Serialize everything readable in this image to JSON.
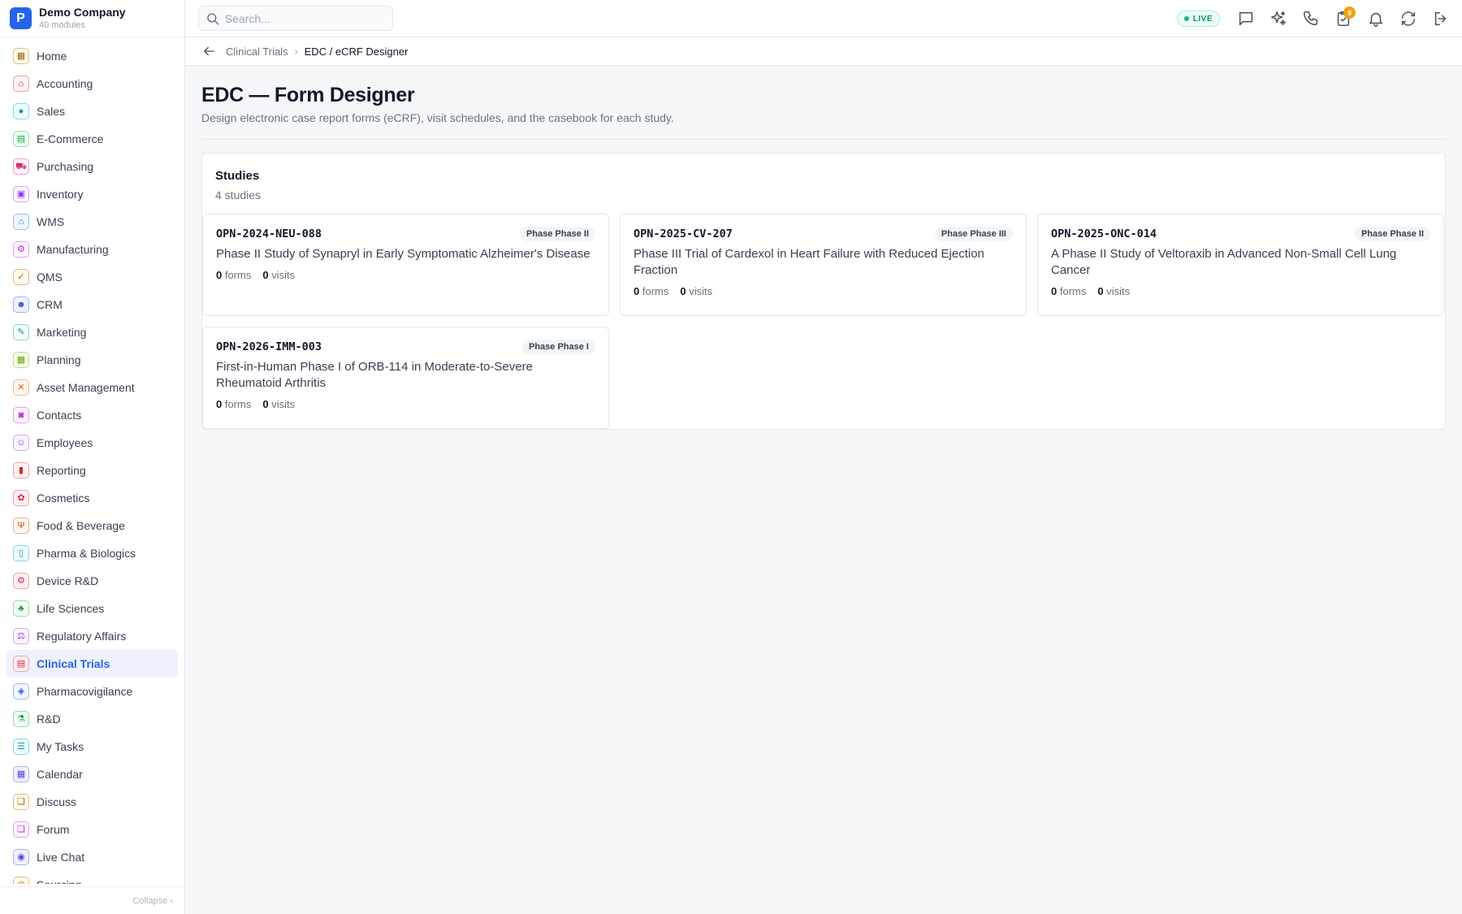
{
  "brand": {
    "logo_letter": "P",
    "name": "Demo Company",
    "subtitle": "40 modules"
  },
  "sidebar": {
    "items": [
      {
        "label": "Home",
        "icon": "home-icon",
        "glyph": "▦",
        "color": "#a16207",
        "bg": "#fefce8",
        "active": false
      },
      {
        "label": "Accounting",
        "icon": "bank-icon",
        "glyph": "⌂",
        "color": "#dc2626",
        "bg": "#fef2f2",
        "active": false
      },
      {
        "label": "Sales",
        "icon": "user-icon",
        "glyph": "●",
        "color": "#0891b2",
        "bg": "#ecfeff",
        "active": false
      },
      {
        "label": "E-Commerce",
        "icon": "store-icon",
        "glyph": "▤",
        "color": "#16a34a",
        "bg": "#f0fdf4",
        "active": false
      },
      {
        "label": "Purchasing",
        "icon": "cart-icon",
        "glyph": "⛟",
        "color": "#db2777",
        "bg": "#fdf2f8",
        "active": false
      },
      {
        "label": "Inventory",
        "icon": "box-icon",
        "glyph": "▣",
        "color": "#9333ea",
        "bg": "#faf5ff",
        "active": false
      },
      {
        "label": "WMS",
        "icon": "warehouse-icon",
        "glyph": "⌂",
        "color": "#2563eb",
        "bg": "#eff6ff",
        "active": false
      },
      {
        "label": "Manufacturing",
        "icon": "factory-icon",
        "glyph": "⚙",
        "color": "#c026d3",
        "bg": "#fdf4ff",
        "active": false
      },
      {
        "label": "QMS",
        "icon": "badge-check-icon",
        "glyph": "✓",
        "color": "#a16207",
        "bg": "#fffbeb",
        "active": false
      },
      {
        "label": "CRM",
        "icon": "users-icon",
        "glyph": "☻",
        "color": "#4f46e5",
        "bg": "#eef2ff",
        "active": false
      },
      {
        "label": "Marketing",
        "icon": "megaphone-icon",
        "glyph": "✎",
        "color": "#0d9488",
        "bg": "#f0fdfa",
        "active": false
      },
      {
        "label": "Planning",
        "icon": "calendar-grid-icon",
        "glyph": "▦",
        "color": "#65a30d",
        "bg": "#f7fee7",
        "active": false
      },
      {
        "label": "Asset Management",
        "icon": "tools-icon",
        "glyph": "✕",
        "color": "#ea580c",
        "bg": "#fff7ed",
        "active": false
      },
      {
        "label": "Contacts",
        "icon": "contact-icon",
        "glyph": "◙",
        "color": "#c026d3",
        "bg": "#fdf4ff",
        "active": false
      },
      {
        "label": "Employees",
        "icon": "briefcase-icon",
        "glyph": "☺",
        "color": "#9333ea",
        "bg": "#faf5ff",
        "active": false
      },
      {
        "label": "Reporting",
        "icon": "bar-chart-icon",
        "glyph": "▮",
        "color": "#dc2626",
        "bg": "#fef2f2",
        "active": false
      },
      {
        "label": "Cosmetics",
        "icon": "flower-icon",
        "glyph": "✿",
        "color": "#e11d48",
        "bg": "#fff1f2",
        "active": false
      },
      {
        "label": "Food & Beverage",
        "icon": "utensils-icon",
        "glyph": "Ψ",
        "color": "#c2410c",
        "bg": "#fff7ed",
        "active": false
      },
      {
        "label": "Pharma & Biologics",
        "icon": "bottle-icon",
        "glyph": "▯",
        "color": "#0891b2",
        "bg": "#ecfeff",
        "active": false
      },
      {
        "label": "Device R&D",
        "icon": "cog-icon",
        "glyph": "⚙",
        "color": "#e11d48",
        "bg": "#fff1f2",
        "active": false
      },
      {
        "label": "Life Sciences",
        "icon": "microscope-icon",
        "glyph": "♣",
        "color": "#16a34a",
        "bg": "#f0fdf4",
        "active": false
      },
      {
        "label": "Regulatory Affairs",
        "icon": "gavel-icon",
        "glyph": "⚖",
        "color": "#9333ea",
        "bg": "#faf5ff",
        "active": false
      },
      {
        "label": "Clinical Trials",
        "icon": "clipboard-icon",
        "glyph": "▤",
        "color": "#e11d48",
        "bg": "#fff1f2",
        "active": true
      },
      {
        "label": "Pharmacovigilance",
        "icon": "shield-icon",
        "glyph": "◈",
        "color": "#2563eb",
        "bg": "#eff6ff",
        "active": false
      },
      {
        "label": "R&D",
        "icon": "flask-icon",
        "glyph": "⚗",
        "color": "#16a34a",
        "bg": "#f0fdf4",
        "active": false
      },
      {
        "label": "My Tasks",
        "icon": "checklist-icon",
        "glyph": "☰",
        "color": "#0891b2",
        "bg": "#ecfeff",
        "active": false
      },
      {
        "label": "Calendar",
        "icon": "calendar-icon",
        "glyph": "▦",
        "color": "#4f46e5",
        "bg": "#eef2ff",
        "active": false
      },
      {
        "label": "Discuss",
        "icon": "chat-icon",
        "glyph": "❏",
        "color": "#a16207",
        "bg": "#fffbeb",
        "active": false
      },
      {
        "label": "Forum",
        "icon": "forum-icon",
        "glyph": "❏",
        "color": "#c026d3",
        "bg": "#fdf4ff",
        "active": false
      },
      {
        "label": "Live Chat",
        "icon": "headset-icon",
        "glyph": "◉",
        "color": "#4f46e5",
        "bg": "#eef2ff",
        "active": false
      },
      {
        "label": "Sourcing",
        "icon": "sourcing-icon",
        "glyph": "◎",
        "color": "#a16207",
        "bg": "#fefce8",
        "active": false
      }
    ],
    "collapse_label": "Collapse ‹"
  },
  "topbar": {
    "search_placeholder": "Search...",
    "live_label": "LIVE",
    "actions": [
      {
        "icon": "message-icon",
        "badge": null
      },
      {
        "icon": "sparkles-icon",
        "badge": null
      },
      {
        "icon": "phone-icon",
        "badge": null
      },
      {
        "icon": "clipboard-check-icon",
        "badge": "9"
      },
      {
        "icon": "bell-icon",
        "badge": null
      },
      {
        "icon": "refresh-icon",
        "badge": null
      },
      {
        "icon": "logout-icon",
        "badge": null
      }
    ]
  },
  "breadcrumb": {
    "parent": "Clinical Trials",
    "separator": "›",
    "current": "EDC / eCRF Designer"
  },
  "page": {
    "title": "EDC — Form Designer",
    "description": "Design electronic case report forms (eCRF), visit schedules, and the casebook for each study."
  },
  "studies": {
    "title": "Studies",
    "count_label": "4 studies",
    "items": [
      {
        "code": "OPN-2024-NEU-088",
        "phase": "Phase Phase II",
        "title": "Phase II Study of Synapryl in Early Symptomatic Alzheimer's Disease",
        "forms": "0",
        "forms_label": "forms",
        "visits": "0",
        "visits_label": "visits"
      },
      {
        "code": "OPN-2025-CV-207",
        "phase": "Phase Phase III",
        "title": "Phase III Trial of Cardexol in Heart Failure with Reduced Ejection Fraction",
        "forms": "0",
        "forms_label": "forms",
        "visits": "0",
        "visits_label": "visits"
      },
      {
        "code": "OPN-2025-ONC-014",
        "phase": "Phase Phase II",
        "title": "A Phase II Study of Veltoraxib in Advanced Non-Small Cell Lung Cancer",
        "forms": "0",
        "forms_label": "forms",
        "visits": "0",
        "visits_label": "visits"
      },
      {
        "code": "OPN-2026-IMM-003",
        "phase": "Phase Phase I",
        "title": "First-in-Human Phase I of ORB-114 in Moderate-to-Severe Rheumatoid Arthritis",
        "forms": "0",
        "forms_label": "forms",
        "visits": "0",
        "visits_label": "visits"
      }
    ]
  }
}
